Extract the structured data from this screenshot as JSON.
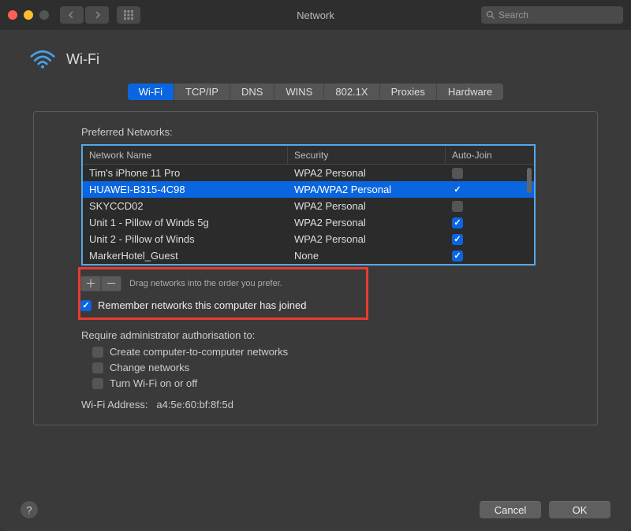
{
  "titlebar": {
    "title": "Network",
    "search_placeholder": "Search"
  },
  "header": {
    "title": "Wi-Fi"
  },
  "tabs": [
    {
      "label": "Wi-Fi",
      "selected": true
    },
    {
      "label": "TCP/IP",
      "selected": false
    },
    {
      "label": "DNS",
      "selected": false
    },
    {
      "label": "WINS",
      "selected": false
    },
    {
      "label": "802.1X",
      "selected": false
    },
    {
      "label": "Proxies",
      "selected": false
    },
    {
      "label": "Hardware",
      "selected": false
    }
  ],
  "preferred_networks": {
    "label": "Preferred Networks:",
    "columns": {
      "name": "Network Name",
      "security": "Security",
      "autojoin": "Auto-Join"
    },
    "rows": [
      {
        "name": "Tim's iPhone 11 Pro",
        "security": "WPA2 Personal",
        "autojoin": false,
        "selected": false
      },
      {
        "name": "HUAWEI-B315-4C98",
        "security": "WPA/WPA2 Personal",
        "autojoin": true,
        "selected": true
      },
      {
        "name": "SKYCCD02",
        "security": "WPA2 Personal",
        "autojoin": false,
        "selected": false
      },
      {
        "name": "Unit 1 - Pillow of Winds 5g",
        "security": "WPA2 Personal",
        "autojoin": true,
        "selected": false
      },
      {
        "name": "Unit 2 - Pillow of Winds",
        "security": "WPA2 Personal",
        "autojoin": true,
        "selected": false
      },
      {
        "name": "MarkerHotel_Guest",
        "security": "None",
        "autojoin": true,
        "selected": false
      }
    ],
    "drag_hint": "Drag networks into the order you prefer.",
    "remember_label": "Remember networks this computer has joined",
    "remember_checked": true
  },
  "admin": {
    "label": "Require administrator authorisation to:",
    "items": [
      {
        "label": "Create computer-to-computer networks",
        "checked": false
      },
      {
        "label": "Change networks",
        "checked": false
      },
      {
        "label": "Turn Wi-Fi on or off",
        "checked": false
      }
    ]
  },
  "wifi_address": {
    "label": "Wi-Fi Address:",
    "value": "a4:5e:60:bf:8f:5d"
  },
  "footer": {
    "cancel": "Cancel",
    "ok": "OK"
  }
}
